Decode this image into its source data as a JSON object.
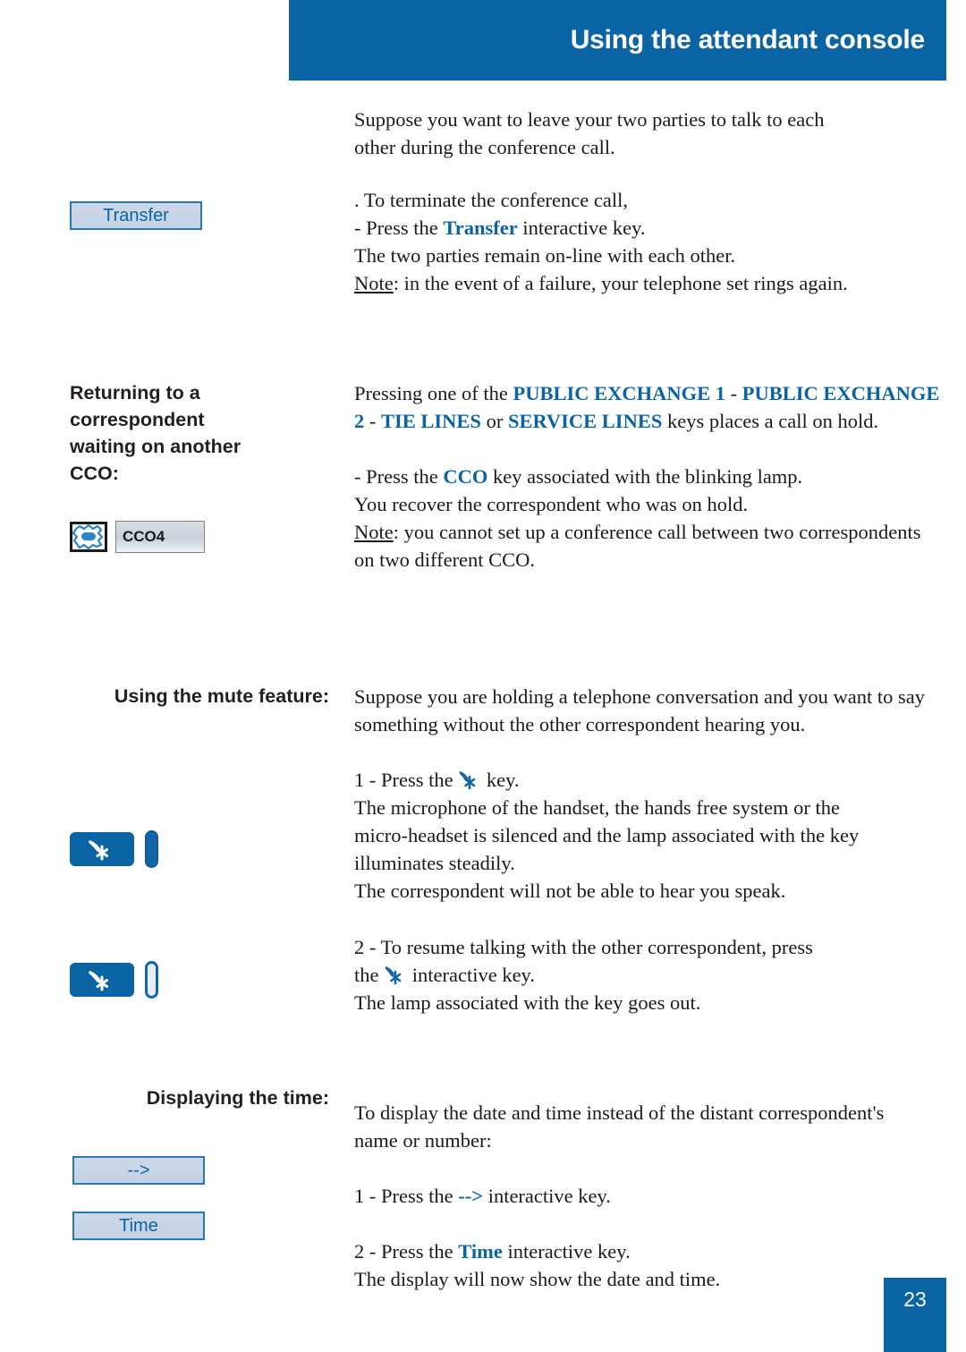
{
  "header": {
    "title": "Using the attendant console"
  },
  "sections": {
    "intro": {
      "line1": "Suppose you want to leave your two parties to talk to each",
      "line2": "other during the conference call."
    },
    "terminate": {
      "heading": ". To terminate the conference call,",
      "step_prefix": "- Press the ",
      "step_key": "Transfer",
      "step_suffix": " interactive key.",
      "italic_note": "The two parties remain on-line with each other.",
      "note_label": "Note",
      "note_text": ": in the event of a failure, your telephone set rings again.",
      "softkey_label": "Transfer"
    },
    "returning": {
      "side_heading": "Returning to a correspondent waiting on another CCO:",
      "side_heading_lines": [
        "Returning to a",
        "correspondent",
        "waiting on another",
        "CCO:"
      ],
      "p1_pre": "Pressing one of the ",
      "p1_key1": "PUBLIC EXCHANGE 1",
      "p1_sep1": " - ",
      "p1_key2": "PUBLIC EXCHANGE 2",
      "p1_sep2": " - ",
      "p1_key3": "TIE LINES",
      "p1_or": " or ",
      "p1_key4": "SERVICE LINES",
      "p1_post": " keys places a call on hold.",
      "p2_pre": "- Press the ",
      "p2_key": "CCO",
      "p2_post": " key associated with the blinking lamp.",
      "p2_line2": "You recover the correspondent who was on hold.",
      "note_label": "Note",
      "note_text": ": you cannot set up a conference call between two correspondents on two different CCO.",
      "icon_lamp_name": "blinking-lamp-icon",
      "icon_label": "CCO4"
    },
    "mute": {
      "side_heading": "Using the mute feature:",
      "p1": "Suppose you are holding a telephone conversation and you want to say something without the other correspondent hearing you.",
      "step1_pre": "1 - Press the ",
      "step1_post": " key.",
      "step1_italic_1": "The microphone of the handset, the hands free system or the",
      "step1_italic_2": "micro-headset is silenced and the lamp associated with the key",
      "step1_italic_3": "illuminates steadily.",
      "step1_italic_4": "The correspondent will not be able to hear you speak.",
      "step2_line1": "2 - To resume talking with the other correspondent, press",
      "step2_pre": "the ",
      "step2_post": " interactive key.",
      "step2_italic": "The lamp associated with the key goes out.",
      "mute_key_icon": "mute-key-icon",
      "lamp_on_name": "lamp-indicator-on",
      "lamp_off_name": "lamp-indicator-off"
    },
    "time": {
      "side_heading": "Displaying the time:",
      "p1_line1": "To display the date and time instead of the distant correspondent's",
      "p1_line2": "name or number:",
      "step1_pre": "1 - Press the ",
      "step1_key": "-->",
      "step1_post": " interactive key.",
      "step2_pre": "2 - Press the ",
      "step2_key": "Time",
      "step2_post": " interactive key.",
      "step2_italic": "The display will now show the date and time.",
      "softkey_arrow_label": "-->",
      "softkey_time_label": "Time"
    }
  },
  "footer": {
    "page_number": "23"
  },
  "colors": {
    "brand_blue": "#0a64a4",
    "text_dark": "#1a1a1a",
    "softkey_fill": "#c9d5e6",
    "softkey_border": "#2878b4"
  }
}
